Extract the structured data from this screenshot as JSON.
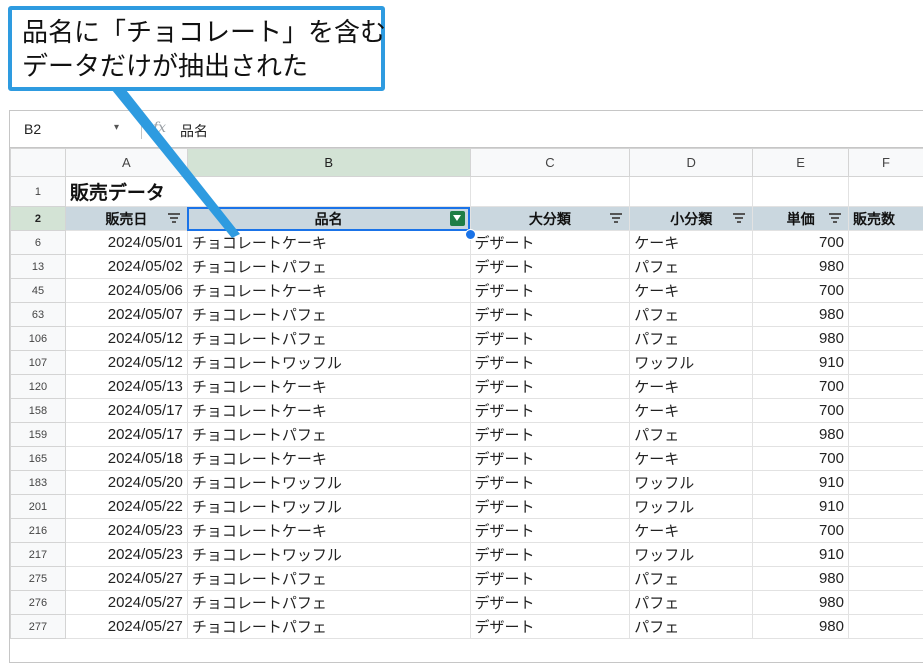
{
  "callout": {
    "line1": "品名に「チョコレート」を含む",
    "line2": "データだけが抽出された"
  },
  "formula_bar": {
    "cell_ref": "B2",
    "caret": "▾",
    "fx": "fx",
    "value": "品名"
  },
  "columns": [
    "A",
    "B",
    "C",
    "D",
    "E",
    "F"
  ],
  "title_row": {
    "row": "1",
    "title": "販売データ"
  },
  "header_row": {
    "row": "2",
    "labels": [
      "販売日",
      "品名",
      "大分類",
      "小分類",
      "単価",
      "販売数"
    ]
  },
  "rows": [
    {
      "row": "6",
      "date": "2024/05/01",
      "name": "チョコレートケーキ",
      "cat": "デザート",
      "sub": "ケーキ",
      "price": "700"
    },
    {
      "row": "13",
      "date": "2024/05/02",
      "name": "チョコレートパフェ",
      "cat": "デザート",
      "sub": "パフェ",
      "price": "980"
    },
    {
      "row": "45",
      "date": "2024/05/06",
      "name": "チョコレートケーキ",
      "cat": "デザート",
      "sub": "ケーキ",
      "price": "700"
    },
    {
      "row": "63",
      "date": "2024/05/07",
      "name": "チョコレートパフェ",
      "cat": "デザート",
      "sub": "パフェ",
      "price": "980"
    },
    {
      "row": "106",
      "date": "2024/05/12",
      "name": "チョコレートパフェ",
      "cat": "デザート",
      "sub": "パフェ",
      "price": "980"
    },
    {
      "row": "107",
      "date": "2024/05/12",
      "name": "チョコレートワッフル",
      "cat": "デザート",
      "sub": "ワッフル",
      "price": "910"
    },
    {
      "row": "120",
      "date": "2024/05/13",
      "name": "チョコレートケーキ",
      "cat": "デザート",
      "sub": "ケーキ",
      "price": "700"
    },
    {
      "row": "158",
      "date": "2024/05/17",
      "name": "チョコレートケーキ",
      "cat": "デザート",
      "sub": "ケーキ",
      "price": "700"
    },
    {
      "row": "159",
      "date": "2024/05/17",
      "name": "チョコレートパフェ",
      "cat": "デザート",
      "sub": "パフェ",
      "price": "980"
    },
    {
      "row": "165",
      "date": "2024/05/18",
      "name": "チョコレートケーキ",
      "cat": "デザート",
      "sub": "ケーキ",
      "price": "700"
    },
    {
      "row": "183",
      "date": "2024/05/20",
      "name": "チョコレートワッフル",
      "cat": "デザート",
      "sub": "ワッフル",
      "price": "910"
    },
    {
      "row": "201",
      "date": "2024/05/22",
      "name": "チョコレートワッフル",
      "cat": "デザート",
      "sub": "ワッフル",
      "price": "910"
    },
    {
      "row": "216",
      "date": "2024/05/23",
      "name": "チョコレートケーキ",
      "cat": "デザート",
      "sub": "ケーキ",
      "price": "700"
    },
    {
      "row": "217",
      "date": "2024/05/23",
      "name": "チョコレートワッフル",
      "cat": "デザート",
      "sub": "ワッフル",
      "price": "910"
    },
    {
      "row": "275",
      "date": "2024/05/27",
      "name": "チョコレートパフェ",
      "cat": "デザート",
      "sub": "パフェ",
      "price": "980"
    },
    {
      "row": "276",
      "date": "2024/05/27",
      "name": "チョコレートパフェ",
      "cat": "デザート",
      "sub": "パフェ",
      "price": "980"
    },
    {
      "row": "277",
      "date": "2024/05/27",
      "name": "チョコレートパフェ",
      "cat": "デザート",
      "sub": "パフェ",
      "price": "980"
    }
  ],
  "colors": {
    "callout_border": "#2e9be0",
    "header_fill": "#cad7df",
    "selected_column": "#d3e3d5",
    "filter_active": "#1e7e45",
    "selection": "#1a73e8"
  }
}
